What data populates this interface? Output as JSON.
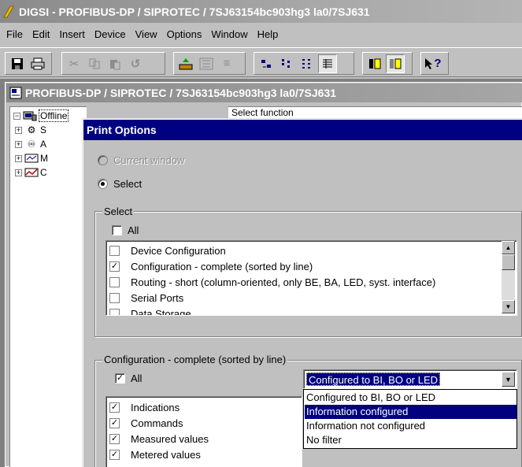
{
  "app": {
    "title": "DIGSI - PROFIBUS-DP / SIPROTEC / 7SJ63154bc903hg3 la0/7SJ631"
  },
  "menu": [
    "File",
    "Edit",
    "Insert",
    "Device",
    "View",
    "Options",
    "Window",
    "Help"
  ],
  "toolbar": {
    "icons": [
      "save-icon",
      "print-icon",
      "cut-icon",
      "copy-icon",
      "paste-icon",
      "undo-icon",
      "upload-icon",
      "download-icon",
      "settings-icon",
      "large-icons-icon",
      "small-icons-icon",
      "list-view-icon",
      "details-view-icon",
      "split-view-icon",
      "split-view-alt-icon",
      "context-help-icon"
    ],
    "help_label": "?"
  },
  "child_window": {
    "title": "PROFIBUS-DP / SIPROTEC / 7SJ63154bc903hg3 la0/7SJ631",
    "root_label": "Offline",
    "tree_items": [
      "S",
      "A",
      "M",
      "C"
    ],
    "right_header": "Select function"
  },
  "dialog": {
    "title": "Print Options",
    "radio_current": "Current window",
    "radio_select": "Select",
    "select_group": {
      "label": "Select",
      "all_label": "All",
      "items": [
        {
          "label": "Device Configuration",
          "checked": false
        },
        {
          "label": "Configuration - complete (sorted by line)",
          "checked": true
        },
        {
          "label": "Routing - short (column-oriented, only BE, BA, LED, syst. interface)",
          "checked": false
        },
        {
          "label": "Serial Ports",
          "checked": false
        },
        {
          "label": "Data Storage",
          "checked": false
        }
      ]
    },
    "config_group": {
      "label": "Configuration - complete (sorted by line)",
      "all_label": "All",
      "filter_value": "Configured to BI, BO or LED",
      "filter_options": [
        {
          "label": "Configured to BI, BO or LED",
          "selected": false
        },
        {
          "label": "Information configured",
          "selected": true
        },
        {
          "label": "Information not configured",
          "selected": false
        },
        {
          "label": "No filter",
          "selected": false
        }
      ],
      "items": [
        {
          "label": "Indications",
          "checked": true
        },
        {
          "label": "Commands",
          "checked": true
        },
        {
          "label": "Measured values",
          "checked": true
        },
        {
          "label": "Metered values",
          "checked": true
        }
      ]
    }
  }
}
